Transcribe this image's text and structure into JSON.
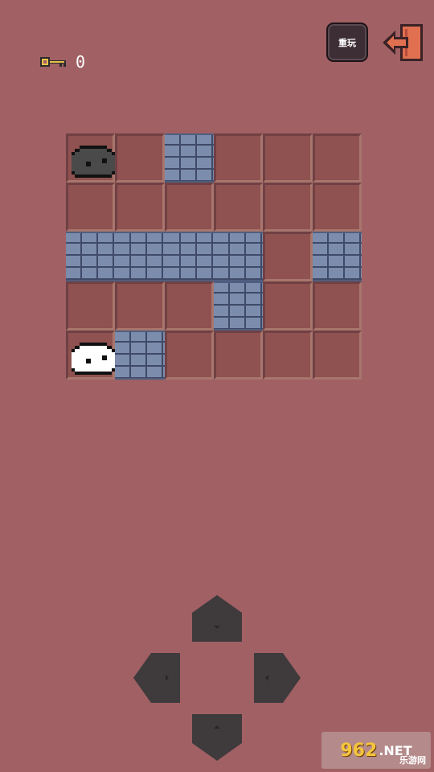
{
  "hud": {
    "key_icon": "key-icon",
    "key_count": "0"
  },
  "toolbar": {
    "restart_label": "重玩",
    "exit_icon": "exit-door-icon"
  },
  "board": {
    "rows": [
      [
        "floor",
        "floor",
        "wall",
        "floor",
        "floor",
        "floor"
      ],
      [
        "floor",
        "floor",
        "floor",
        "floor",
        "floor",
        "floor"
      ],
      [
        "wall",
        "wall",
        "wall",
        "wall",
        "floor",
        "wall"
      ],
      [
        "floor",
        "floor",
        "floor",
        "wall",
        "floor",
        "floor"
      ],
      [
        "floor",
        "wall",
        "floor",
        "floor",
        "floor",
        "floor"
      ]
    ],
    "enemy": {
      "name": "dark-slime",
      "row": 0,
      "col": 0
    },
    "player": {
      "name": "white-slime",
      "row": 4,
      "col": 0
    }
  },
  "dpad": {
    "up": "arrow-up-icon",
    "down": "arrow-down-icon",
    "left": "arrow-left-icon",
    "right": "arrow-right-icon"
  },
  "watermark": {
    "number": "962",
    "suffix": ".NET",
    "subtitle": "乐游网"
  },
  "colors": {
    "background": "#a06064",
    "floor": "#8f5250",
    "wall": "#7c8cad",
    "button": "#3d2d34",
    "exit": "#e07050"
  }
}
